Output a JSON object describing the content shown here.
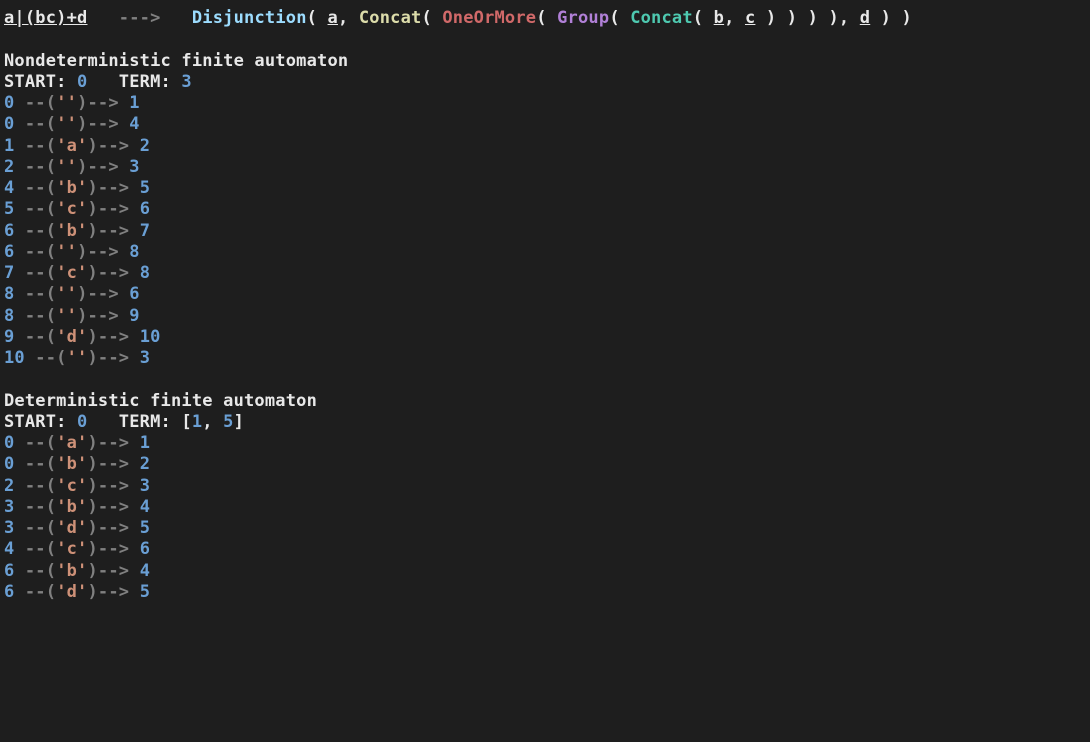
{
  "parse": {
    "input": "a|(bc)+d",
    "arrow": "--->",
    "fn_disjunction": "Disjunction",
    "fn_concat": "Concat",
    "fn_oneormore": "OneOrMore",
    "fn_group": "Group",
    "arg_a": "a",
    "arg_b": "b",
    "arg_c": "c",
    "arg_d": "d"
  },
  "nfa": {
    "title": "Nondeterministic finite automaton",
    "start_label": "START:",
    "term_label": "TERM:",
    "start": "0",
    "term": "3",
    "transitions": [
      {
        "from": "0",
        "sym": "''",
        "to": "1"
      },
      {
        "from": "0",
        "sym": "''",
        "to": "4"
      },
      {
        "from": "1",
        "sym": "'a'",
        "to": "2"
      },
      {
        "from": "2",
        "sym": "''",
        "to": "3"
      },
      {
        "from": "4",
        "sym": "'b'",
        "to": "5"
      },
      {
        "from": "5",
        "sym": "'c'",
        "to": "6"
      },
      {
        "from": "6",
        "sym": "'b'",
        "to": "7"
      },
      {
        "from": "6",
        "sym": "''",
        "to": "8"
      },
      {
        "from": "7",
        "sym": "'c'",
        "to": "8"
      },
      {
        "from": "8",
        "sym": "''",
        "to": "6"
      },
      {
        "from": "8",
        "sym": "''",
        "to": "9"
      },
      {
        "from": "9",
        "sym": "'d'",
        "to": "10"
      },
      {
        "from": "10",
        "sym": "''",
        "to": "3"
      }
    ]
  },
  "dfa": {
    "title": "Deterministic finite automaton",
    "start_label": "START:",
    "term_label": "TERM:",
    "start": "0",
    "term_open": "[",
    "term_a": "1",
    "term_sep": ", ",
    "term_b": "5",
    "term_close": "]",
    "transitions": [
      {
        "from": "0",
        "sym": "'a'",
        "to": "1"
      },
      {
        "from": "0",
        "sym": "'b'",
        "to": "2"
      },
      {
        "from": "2",
        "sym": "'c'",
        "to": "3"
      },
      {
        "from": "3",
        "sym": "'b'",
        "to": "4"
      },
      {
        "from": "3",
        "sym": "'d'",
        "to": "5"
      },
      {
        "from": "4",
        "sym": "'c'",
        "to": "6"
      },
      {
        "from": "6",
        "sym": "'b'",
        "to": "4"
      },
      {
        "from": "6",
        "sym": "'d'",
        "to": "5"
      }
    ]
  }
}
